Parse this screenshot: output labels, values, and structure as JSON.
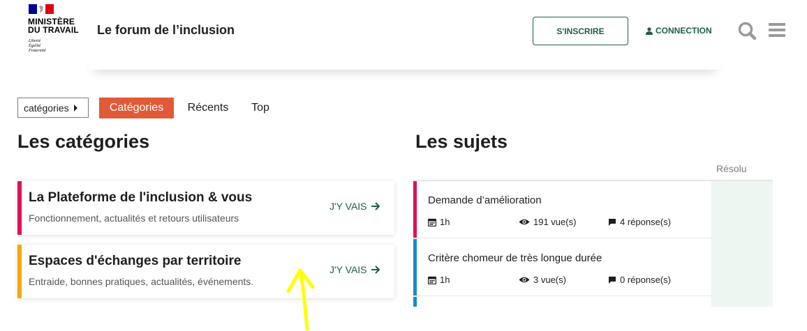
{
  "header": {
    "ministry_line1": "MINISTÈRE",
    "ministry_line2": "DU TRAVAIL",
    "devise_1": "Liberté",
    "devise_2": "Égalité",
    "devise_3": "Fraternité",
    "site_title": "Le forum de l’inclusion",
    "signup_label": "S'INSCRIRE",
    "login_label": "CONNECTION"
  },
  "nav": {
    "select_label": "catégories",
    "tabs": [
      {
        "label": "Catégories",
        "active": true
      },
      {
        "label": "Récents",
        "active": false
      },
      {
        "label": "Top",
        "active": false
      }
    ]
  },
  "categories": {
    "heading": "Les catégories",
    "items": [
      {
        "title": "La Plateforme de l'inclusion & vous",
        "description": "Fonctionnement, actualités et retours utilisateurs",
        "action": "J'Y VAIS",
        "color": "#e0105a"
      },
      {
        "title": "Espaces d'échanges par territoire",
        "description": "Entraide, bonnes pratiques, actualités, événements.",
        "action": "J'Y VAIS",
        "color": "#f5a800"
      }
    ]
  },
  "topics": {
    "heading": "Les sujets",
    "column_resolu": "Résolu",
    "items": [
      {
        "title": "Demande d’amélioration",
        "age": "1h",
        "views": "191 vue(s)",
        "replies": "4 réponse(s)",
        "color": "#e0105a"
      },
      {
        "title": "Critère chomeur de très longue durée",
        "age": "1h",
        "views": "3 vue(s)",
        "replies": "0 réponse(s)",
        "color": "#1a8ac8"
      }
    ]
  },
  "colors": {
    "accent_green": "#1e5c4e",
    "active_tab": "#e05a37",
    "annotation_yellow": "#ffff00"
  }
}
